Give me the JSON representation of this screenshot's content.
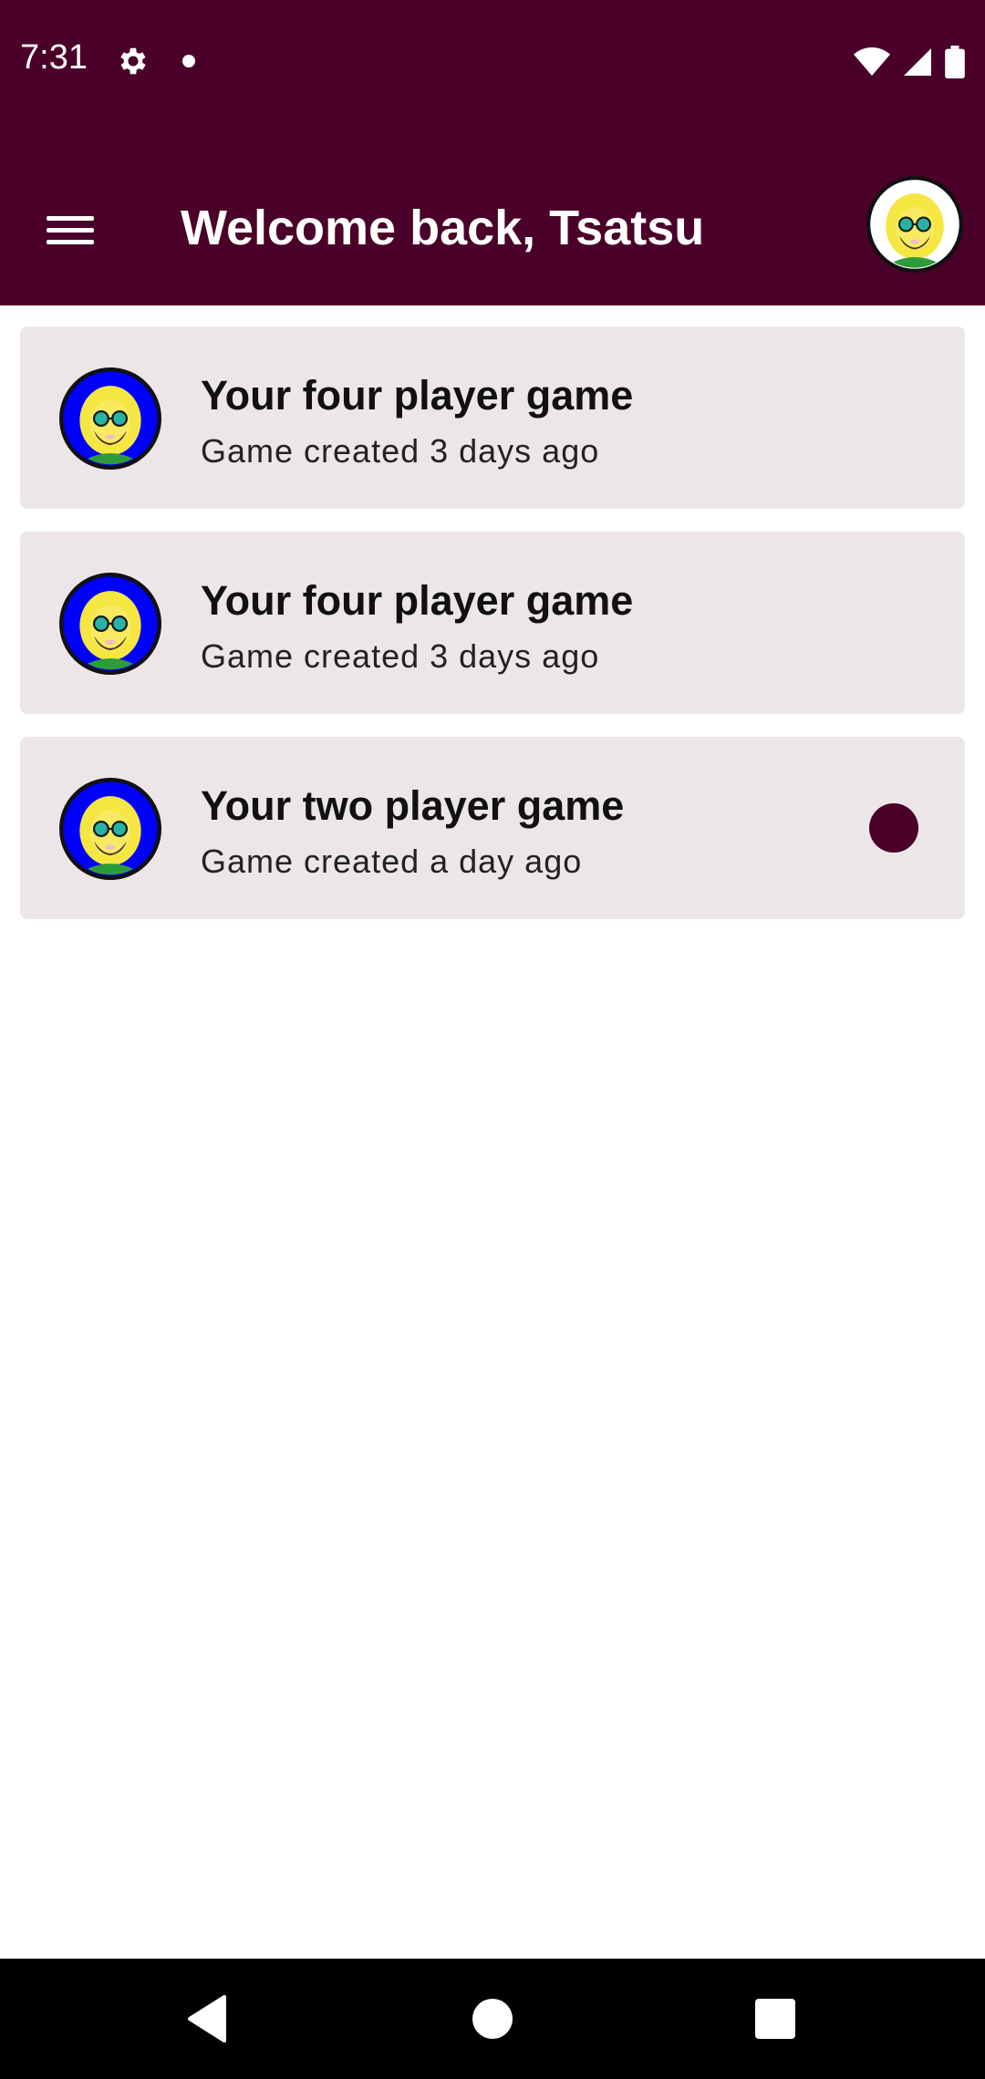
{
  "status_bar": {
    "time": "7:31",
    "icons": [
      "gear-icon",
      "notification-dot-icon",
      "wifi-icon",
      "cell-signal-icon",
      "battery-icon"
    ]
  },
  "app_bar": {
    "menu_icon": "hamburger-menu-icon",
    "title": "Welcome back, Tsatsu",
    "avatar": "profile-avatar"
  },
  "games": [
    {
      "title": "Your four player game",
      "subtitle": "Game created 3 days ago",
      "unread": false
    },
    {
      "title": "Your four player game",
      "subtitle": "Game created 3 days ago",
      "unread": false
    },
    {
      "title": "Your two player game",
      "subtitle": "Game created a day ago",
      "unread": true
    }
  ],
  "nav_bar": {
    "icons": [
      "back-icon",
      "home-icon",
      "recents-icon"
    ]
  },
  "colors": {
    "primary": "#4a0029",
    "card_background": "#ece6e8",
    "avatar_ring_blue": "#0000ff",
    "avatar_hair": "#f5e642"
  }
}
